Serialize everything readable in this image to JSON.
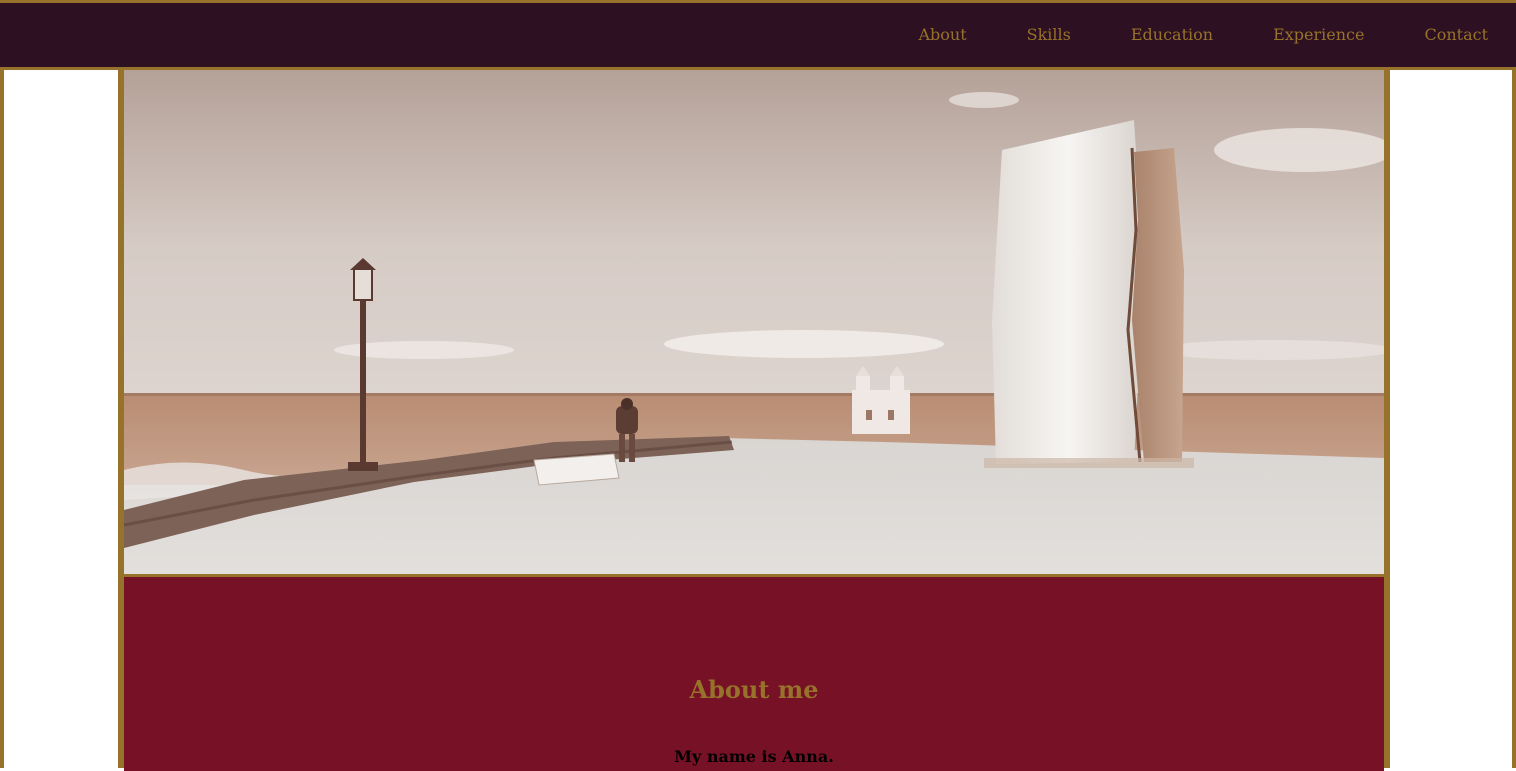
{
  "nav": {
    "items": [
      {
        "label": "About"
      },
      {
        "label": "Skills"
      },
      {
        "label": "Education"
      },
      {
        "label": "Experience"
      },
      {
        "label": "Contact"
      }
    ]
  },
  "hero": {
    "image_name": "seaside-monument-photo"
  },
  "about": {
    "title": "About me",
    "text": "My name is Anna."
  },
  "colors": {
    "nav_bg": "#2d1022",
    "accent": "#97722a",
    "about_bg": "#771126"
  }
}
